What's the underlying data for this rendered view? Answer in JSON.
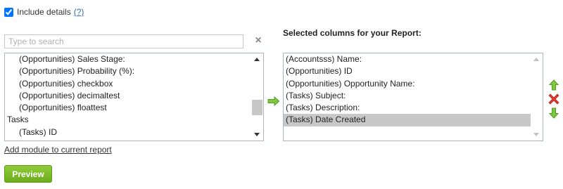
{
  "include_details": {
    "label": "Include details",
    "help_link": "(?)",
    "checked": true
  },
  "search": {
    "placeholder": "Type to search",
    "value": ""
  },
  "available": {
    "rows": [
      {
        "label": "(Opportunities) Sales Stage:",
        "indent": true
      },
      {
        "label": "(Opportunities) Probability (%):",
        "indent": true
      },
      {
        "label": "(Opportunities) checkbox",
        "indent": true
      },
      {
        "label": "(Opportunities) decimaltest",
        "indent": true
      },
      {
        "label": "(Opportunities) floattest",
        "indent": true
      },
      {
        "label": "Tasks",
        "indent": false
      },
      {
        "label": "(Tasks) ID",
        "indent": true
      }
    ]
  },
  "selected": {
    "title": "Selected columns for your Report:",
    "rows": [
      {
        "label": "(Accountsss) Name:",
        "selected": false
      },
      {
        "label": "(Opportunities) ID",
        "selected": false
      },
      {
        "label": "(Opportunities) Opportunity Name:",
        "selected": false
      },
      {
        "label": "(Tasks) Subject:",
        "selected": false
      },
      {
        "label": "(Tasks) Description:",
        "selected": false
      },
      {
        "label": "(Tasks) Date Created",
        "selected": true
      }
    ]
  },
  "links": {
    "add_module": "Add module to current report"
  },
  "buttons": {
    "preview": "Preview"
  },
  "icons": {
    "clear": "close-icon",
    "move_right": "right-arrow-icon",
    "move_up": "up-arrow-icon",
    "remove": "remove-icon",
    "move_down": "down-arrow-icon"
  },
  "colors": {
    "accent_green": "#5aa81e",
    "remove_red": "#e03030",
    "link_blue": "#2a6ebb",
    "preview_green": "#7fbe2a"
  }
}
